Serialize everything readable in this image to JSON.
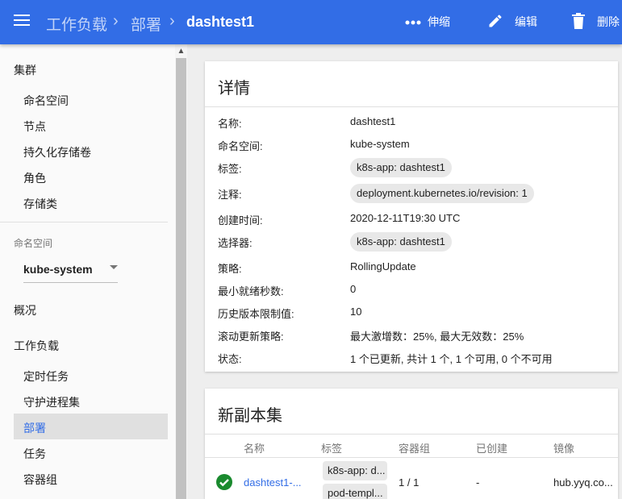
{
  "topbar": {
    "breadcrumbs": [
      "工作负载",
      "部署",
      "dashtest1"
    ],
    "actions": [
      {
        "label": "伸缩",
        "icon": "scale-icon"
      },
      {
        "label": "编辑",
        "icon": "edit-icon"
      },
      {
        "label": "删除",
        "icon": "delete-icon"
      }
    ]
  },
  "sidebar": {
    "cluster": {
      "title": "集群",
      "items": [
        "命名空间",
        "节点",
        "持久化存储卷",
        "角色",
        "存储类"
      ]
    },
    "namespace": {
      "label": "命名空间",
      "value": "kube-system"
    },
    "overview": "概况",
    "workloads": {
      "title": "工作负载",
      "items": [
        "定时任务",
        "守护进程集",
        "部署",
        "任务",
        "容器组"
      ],
      "active_index": 2
    }
  },
  "details": {
    "title": "详情",
    "rows": [
      {
        "label": "名称:",
        "value": "dashtest1"
      },
      {
        "label": "命名空间:",
        "value": "kube-system"
      },
      {
        "label": "标签:",
        "value": "k8s-app: dashtest1"
      },
      {
        "label": "注释:",
        "value": "deployment.kubernetes.io/revision:  1"
      },
      {
        "label": "创建时间:",
        "value": "2020-12-11T19:30 UTC"
      },
      {
        "label": "选择器:",
        "value": "k8s-app: dashtest1"
      },
      {
        "label": "策略:",
        "value": "RollingUpdate"
      },
      {
        "label": "最小就绪秒数:",
        "value": "0"
      },
      {
        "label": "历史版本限制值:",
        "value": "10"
      },
      {
        "label": "滚动更新策略:",
        "value": "最大激增数：25%, 最大无效数：25%"
      },
      {
        "label": "状态:",
        "value": "1 个已更新, 共计 1 个, 1 个可用, 0 个不可用"
      }
    ]
  },
  "replicasets": {
    "title": "新副本集",
    "columns": [
      "名称",
      "标签",
      "容器组",
      "已创建",
      "镜像"
    ],
    "rows": [
      {
        "status": "ok",
        "name": "dashtest1-...",
        "labels": [
          "k8s-app: d...",
          "pod-templ..."
        ],
        "pods": "1 / 1",
        "created": "-",
        "image": "hub.yyq.co..."
      }
    ]
  },
  "colors": {
    "primary": "#326de6",
    "success": "#1a8a2e"
  }
}
